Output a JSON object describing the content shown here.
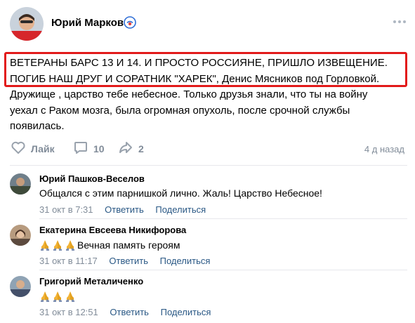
{
  "post": {
    "author": "Юрий Марков",
    "text_lines": [
      "ВЕТЕРАНЫ БАРС 13 И 14. И ПРОСТО РОССИЯНЕ, ПРИШЛО ИЗВЕЩЕНИЕ.",
      "ПОГИБ НАШ ДРУГ И СОРАТНИК \"ХАРЕК\", Денис Мясников под Горловкой.",
      "Дружище , царство тебе небесное. Только друзья знали, что ты на войну",
      "уехал с Раком мозга, была огромная опухоль, после срочной службы",
      "появилась."
    ],
    "like_label": "Лайк",
    "comments_count": "10",
    "shares_count": "2",
    "time_ago": "4 д назад"
  },
  "comments": [
    {
      "name": "Юрий Пашков-Веселов",
      "text": "Общался с этим парнишкой лично. Жаль! Царство Небесное!",
      "prayer_emoji_count": 0,
      "date": "31 окт в 7:31",
      "reply": "Ответить",
      "share": "Поделиться"
    },
    {
      "name": "Екатерина Евсеева Никифорова",
      "text": "Вечная память героям",
      "prayer_emoji_count": 3,
      "date": "31 окт в 11:17",
      "reply": "Ответить",
      "share": "Поделиться"
    },
    {
      "name": "Григорий Металиченко",
      "text": "",
      "prayer_emoji_count": 3,
      "date": "31 окт в 12:51",
      "reply": "Ответить",
      "share": "Поделиться"
    }
  ],
  "icons": {
    "verified": "verified-badge-icon",
    "more": "more-dots-icon",
    "like": "heart-icon",
    "comment": "comment-bubble-icon",
    "share": "share-arrow-icon",
    "emoji": "praying-hands-emoji"
  },
  "colors": {
    "highlight_border": "#e21a1a",
    "muted": "#818c99",
    "link": "#2a5885"
  }
}
